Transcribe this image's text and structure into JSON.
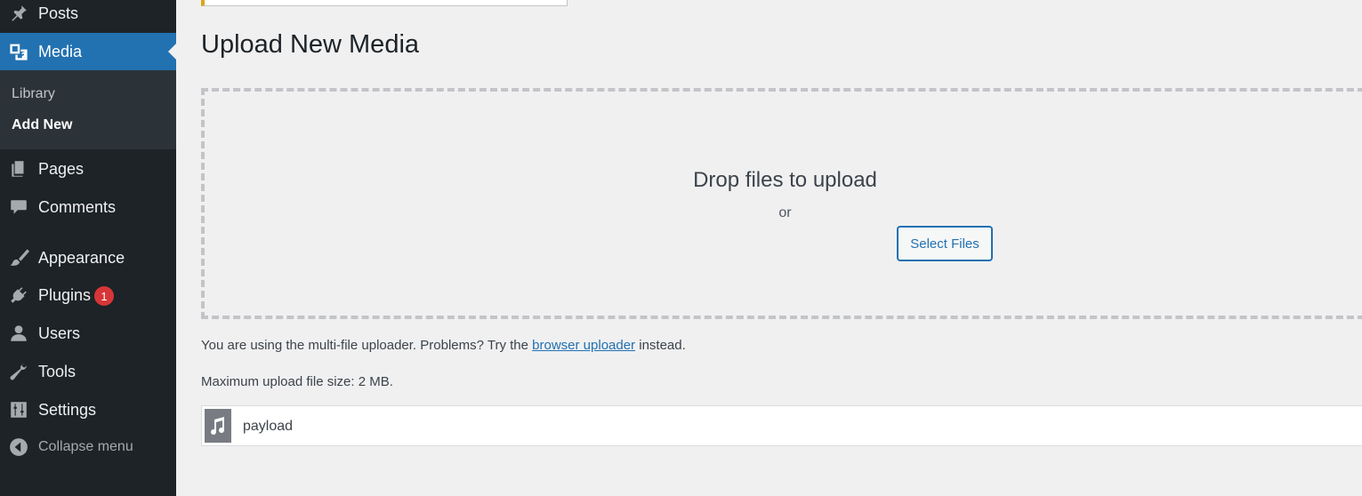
{
  "sidebar": {
    "items": [
      {
        "label": "Posts",
        "icon": "pin-icon"
      },
      {
        "label": "Media",
        "icon": "media-icon"
      },
      {
        "label": "Pages",
        "icon": "pages-icon"
      },
      {
        "label": "Comments",
        "icon": "comment-icon"
      },
      {
        "label": "Appearance",
        "icon": "brush-icon"
      },
      {
        "label": "Plugins",
        "icon": "plug-icon",
        "badge": "1"
      },
      {
        "label": "Users",
        "icon": "user-icon"
      },
      {
        "label": "Tools",
        "icon": "wrench-icon"
      },
      {
        "label": "Settings",
        "icon": "sliders-icon"
      }
    ],
    "submenu": [
      {
        "label": "Library"
      },
      {
        "label": "Add New"
      }
    ],
    "collapse_label": "Collapse menu"
  },
  "page": {
    "title": "Upload New Media"
  },
  "uploader": {
    "drop_text": "Drop files to upload",
    "or_text": "or",
    "select_button": "Select Files",
    "info_prefix": "You are using the multi-file uploader. Problems? Try the",
    "info_link": "browser uploader",
    "info_suffix": "instead.",
    "max_size": "Maximum upload file size: 2 MB."
  },
  "media_items": [
    {
      "filename": "payload",
      "icon": "audio-file-icon"
    }
  ],
  "colors": {
    "accent": "#2271b1",
    "sidebar_bg": "#1d2327",
    "badge": "#d63638",
    "notice_border": "#dba617"
  }
}
